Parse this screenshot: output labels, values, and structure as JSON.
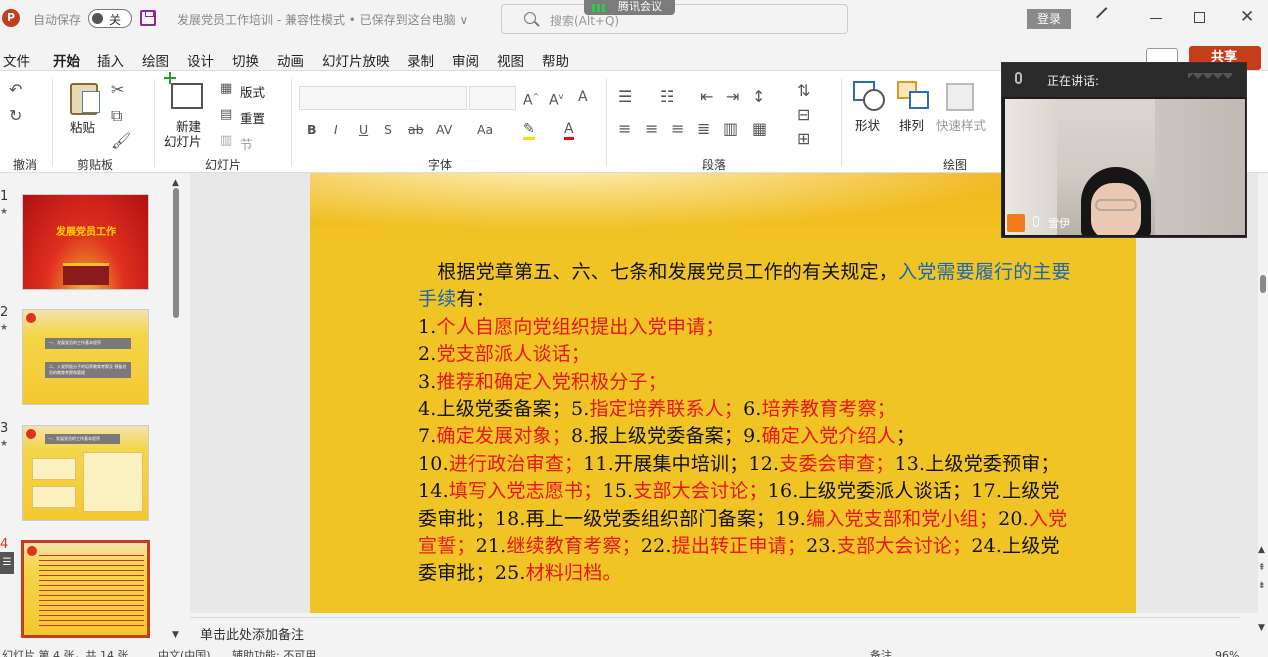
{
  "titlebar": {
    "app_logo": "P",
    "autosave_label": "自动保存",
    "autosave_state": "关",
    "doc_title": "发展党员工作培训 - 兼容性模式 • 已保存到这台电脑 ∨",
    "search_placeholder": "搜索(Alt+Q)",
    "meeting_badge": "腾讯会议",
    "login_label": "登录"
  },
  "menu": {
    "items": [
      "文件",
      "开始",
      "插入",
      "绘图",
      "设计",
      "切换",
      "动画",
      "幻灯片放映",
      "录制",
      "审阅",
      "视图",
      "帮助"
    ],
    "active": "开始",
    "share_label": "共享"
  },
  "ribbon": {
    "groups": [
      "撤消",
      "剪贴板",
      "幻灯片",
      "字体",
      "段落",
      "绘图"
    ],
    "paste_label": "粘贴",
    "new_slide_label": "新建",
    "new_slide_label2": "幻灯片",
    "layout_label": "版式",
    "reset_label": "重置",
    "section_label": "节",
    "shape_label": "形状",
    "arrange_label": "排列",
    "quickstyle_label": "快速样式",
    "font_buttons": [
      "B",
      "I",
      "U",
      "S",
      "ab",
      "AV",
      "Aa"
    ]
  },
  "thumbnails": {
    "numbers": [
      "1",
      "2",
      "3",
      "4"
    ],
    "slide1_title": "发展党员工作",
    "slide2_lines": [
      "一、发展党员的工作基本程序",
      "二、入党积极分子的培养教育考察及  预备党员的教育考察和管理"
    ],
    "slide3_title": "一、发展党员的工作基本程序"
  },
  "slide": {
    "p1_intro": "根据党章第五、六、七条和发展党员工作的有关规定，",
    "p1_blue": "入党需要履行的主要手续",
    "p1_tail": "有：",
    "steps": [
      {
        "num": "1.",
        "red": "个人自愿向党组织提出入党申请；"
      },
      {
        "num": "2.",
        "red": "党支部派人谈话；"
      },
      {
        "num": "3.",
        "red": "推荐和确定入党积极分子；"
      }
    ],
    "line4": [
      "4.上级党委备案；",
      "5.",
      "指定培养联系人；",
      "6.",
      "培养教育考察；"
    ],
    "line7": [
      "7.",
      "确定发展对象；",
      "8.报上级党委备案；",
      "9.",
      "确定入党介绍人",
      "；"
    ],
    "rest": [
      "10.",
      "进行政治审查；",
      "11.开展集中培训；",
      "12.",
      "支委会审查；",
      "13.上级党委预审；",
      "14.",
      "填写入党志愿书；",
      "15.",
      "支部大会讨论；",
      "16.上级党委派人谈话；",
      "17.上级党委审批；",
      "18.再上一级党委组织部门备案；",
      "19.",
      "编入党支部和党小组；",
      "20.",
      "入党宣誓；",
      "21.",
      "继续教育考察；",
      "22.",
      "提出转正申请；",
      "23.",
      "支部大会讨论；",
      "24.上级党委审批；",
      "25.",
      "材料归档。"
    ]
  },
  "notes_placeholder": "单击此处添加备注",
  "video": {
    "speaking_label": "正在讲话:",
    "participant_name": "雪伊"
  },
  "status": {
    "slide_info": "幻灯片 第 4 张，共 14 张",
    "language": "中文(中国)",
    "accessibility": "辅助功能: 不可用",
    "notes": "备注",
    "zoom": "96%"
  },
  "colors": {
    "accent": "#c43e1c",
    "slide_bg": "#f0c425",
    "red_text": "#e8141c",
    "blue_text": "#1a66b8"
  }
}
